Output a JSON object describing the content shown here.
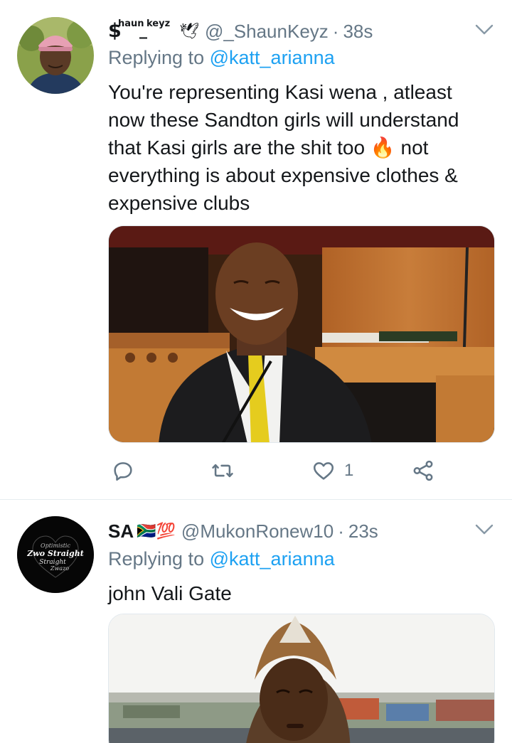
{
  "tweets": [
    {
      "display_name": {
        "dollar": "$",
        "sup1": "haun",
        "underscore": "_",
        "sup2": "keyz",
        "emoji": "🕊"
      },
      "handle": "@_ShaunKeyz",
      "separator": "·",
      "time": "38s",
      "replying_prefix": "Replying to",
      "replying_mention": "@katt_arianna",
      "text": "You're representing Kasi wena , atleast now these Sandton girls will understand that Kasi girls are the shit too 🔥 not everything is about expensive clothes & expensive clubs",
      "actions": {
        "reply_icon": "reply-icon",
        "retweet_icon": "retweet-icon",
        "like_icon": "heart-icon",
        "like_count": "1",
        "share_icon": "share-icon"
      }
    },
    {
      "display_name": {
        "text": "SA",
        "emoji": "🇿🇦💯"
      },
      "handle": "@MukonRonew10",
      "separator": "·",
      "time": "23s",
      "replying_prefix": "Replying to",
      "replying_mention": "@katt_arianna",
      "text": "john Vali Gate",
      "avatar_text": [
        "Optimistic",
        "Zwo Straight",
        "Straight",
        "Zwazo"
      ]
    }
  ],
  "colors": {
    "text": "#14171a",
    "secondary": "#657786",
    "link": "#1da1f2",
    "divider": "#e6ecf0"
  }
}
